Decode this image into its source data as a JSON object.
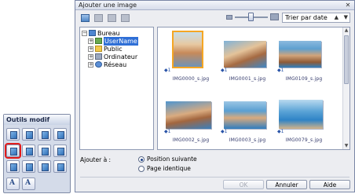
{
  "palette": {
    "title": "Outils modif",
    "text_button_label": "A"
  },
  "dialog": {
    "title": "Ajouter une image",
    "close_glyph": "✕",
    "sort": {
      "selected": "Trier par date",
      "direction_glyph": "▲",
      "dropdown_glyph": "▼"
    },
    "tree": {
      "expand_glyph": "+",
      "collapse_glyph": "−",
      "items": [
        {
          "label": "Bureau"
        },
        {
          "label": "UserName"
        },
        {
          "label": "Public"
        },
        {
          "label": "Ordinateur"
        },
        {
          "label": "Réseau"
        }
      ]
    },
    "thumbnails": [
      {
        "filename": "IMG0000_s.jpg",
        "badge": "1"
      },
      {
        "filename": "IMG0001_s.jpg",
        "badge": "1"
      },
      {
        "filename": "IMG0109_s.jpg",
        "badge": "1"
      },
      {
        "filename": "IMG0002_s.jpg",
        "badge": "1"
      },
      {
        "filename": "IMG0003_s.jpg",
        "badge": "1"
      },
      {
        "filename": "IMG0079_s.jpg",
        "badge": "1"
      }
    ],
    "scroll": {
      "up_glyph": "▲",
      "down_glyph": "▼"
    },
    "add_label": "Ajouter à :",
    "options": [
      {
        "label": "Position suivante",
        "checked": true
      },
      {
        "label": "Page identique",
        "checked": false
      }
    ],
    "buttons": {
      "ok": "OK",
      "cancel": "Annuler",
      "help": "Aide"
    }
  },
  "colors": {
    "selection": "#2f6fd6",
    "highlight_outline": "#e11b1b"
  }
}
